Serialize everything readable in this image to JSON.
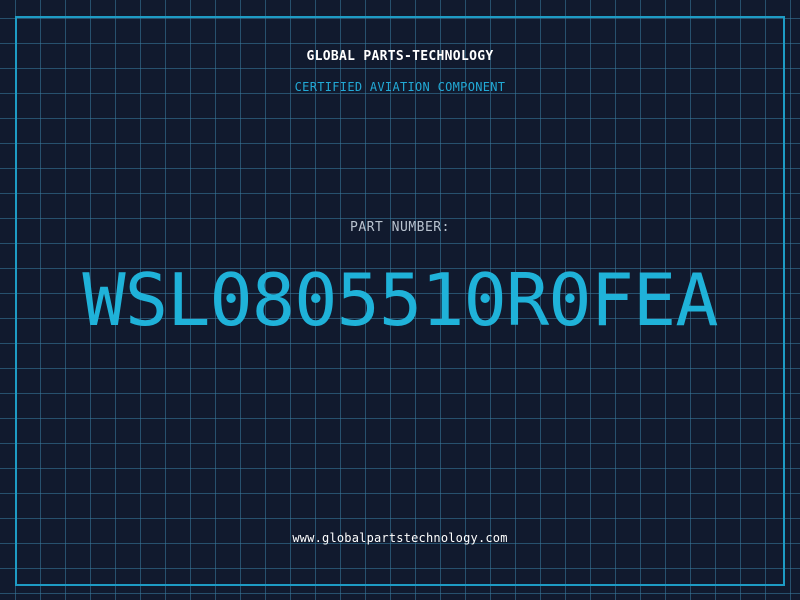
{
  "header": {
    "company_name": "GLOBAL PARTS-TECHNOLOGY",
    "subtitle": "CERTIFIED AVIATION COMPONENT"
  },
  "part": {
    "label": "PART NUMBER:",
    "number": "WSL0805510R0FEA"
  },
  "footer": {
    "website": "www.globalpartstechnology.com"
  },
  "colors": {
    "background": "#111a2e",
    "grid": "#387ca0",
    "accent": "#1fb2d9",
    "frame": "#1e9bc4",
    "text_primary": "#ffffff",
    "text_muted": "#b9c3cf"
  }
}
